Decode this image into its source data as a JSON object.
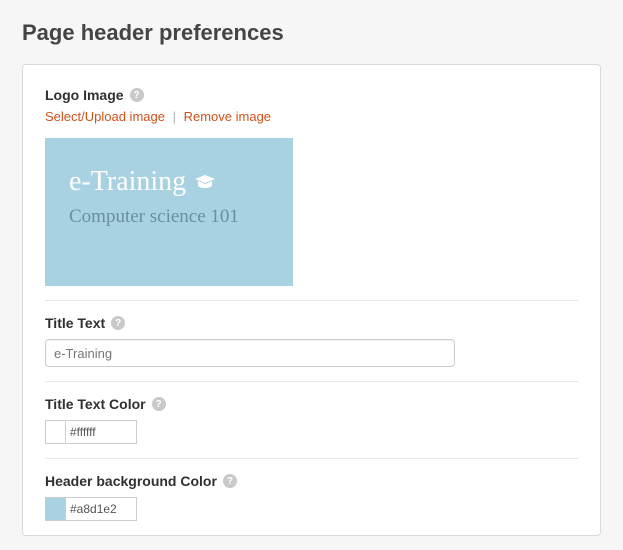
{
  "page": {
    "title": "Page header preferences"
  },
  "logo": {
    "label": "Logo Image",
    "select_label": "Select/Upload image",
    "remove_label": "Remove image",
    "preview": {
      "line1": "e-Training",
      "line2": "Computer science 101",
      "bg": "#a8d1e2",
      "line1_color": "#ffffff",
      "line2_color": "#6a8fa1",
      "icon_color": "#ffffff"
    }
  },
  "title_text": {
    "label": "Title Text",
    "value": "e-Training"
  },
  "title_color": {
    "label": "Title Text Color",
    "value": "#ffffff"
  },
  "bg_color": {
    "label": "Header background Color",
    "value": "#a8d1e2"
  }
}
